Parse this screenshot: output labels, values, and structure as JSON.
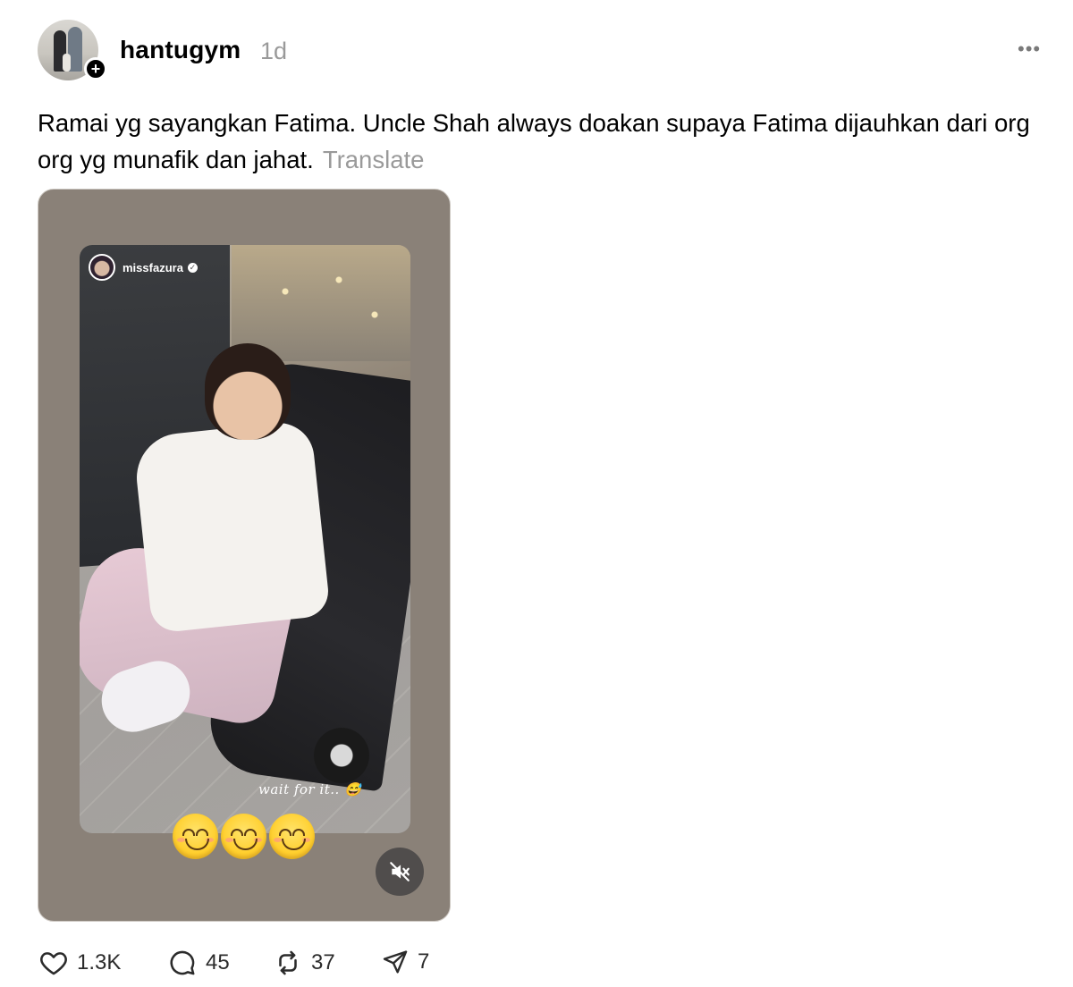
{
  "post": {
    "username": "hantugym",
    "time": "1d",
    "more_label": "•••",
    "caption": "Ramai yg sayangkan Fatima. Uncle Shah always doakan supaya Fatima dijauhkan dari org org yg munafik dan jahat.",
    "translate_label": "Translate"
  },
  "media": {
    "story_user": "missfazura",
    "story_caption": "wait for it.. 😅",
    "emojis": [
      "😊",
      "😊",
      "😊"
    ]
  },
  "actions": {
    "likes": "1.3K",
    "comments": "45",
    "reposts": "37",
    "shares": "7"
  },
  "icons": {
    "follow": "plus-icon",
    "mute": "speaker-muted-icon",
    "like": "heart-icon",
    "comment": "comment-bubble-icon",
    "repost": "repost-icon",
    "share": "send-icon"
  }
}
